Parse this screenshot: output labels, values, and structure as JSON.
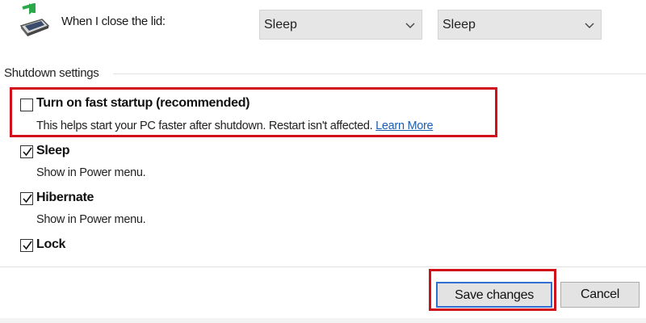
{
  "lid_row": {
    "label": "When I close the lid:",
    "on_battery": "Sleep",
    "plugged_in": "Sleep"
  },
  "shutdown": {
    "title": "Shutdown settings",
    "fast_startup": {
      "label": "Turn on fast startup (recommended)",
      "checked": false,
      "desc": "This helps start your PC faster after shutdown. Restart isn't affected.",
      "link": "Learn More"
    },
    "sleep": {
      "label": "Sleep",
      "checked": true,
      "desc": "Show in Power menu."
    },
    "hibernate": {
      "label": "Hibernate",
      "checked": true,
      "desc": "Show in Power menu."
    },
    "lock": {
      "label": "Lock",
      "checked": true
    }
  },
  "buttons": {
    "save": "Save changes",
    "cancel": "Cancel"
  },
  "colors": {
    "highlight": "#d0111b",
    "link": "#1a5fb4",
    "focus": "#2f6fcf"
  },
  "icons": {
    "lid": "laptop-lid-arrow-icon",
    "dropdown": "chevron-down-icon",
    "check": "checkmark-icon"
  }
}
